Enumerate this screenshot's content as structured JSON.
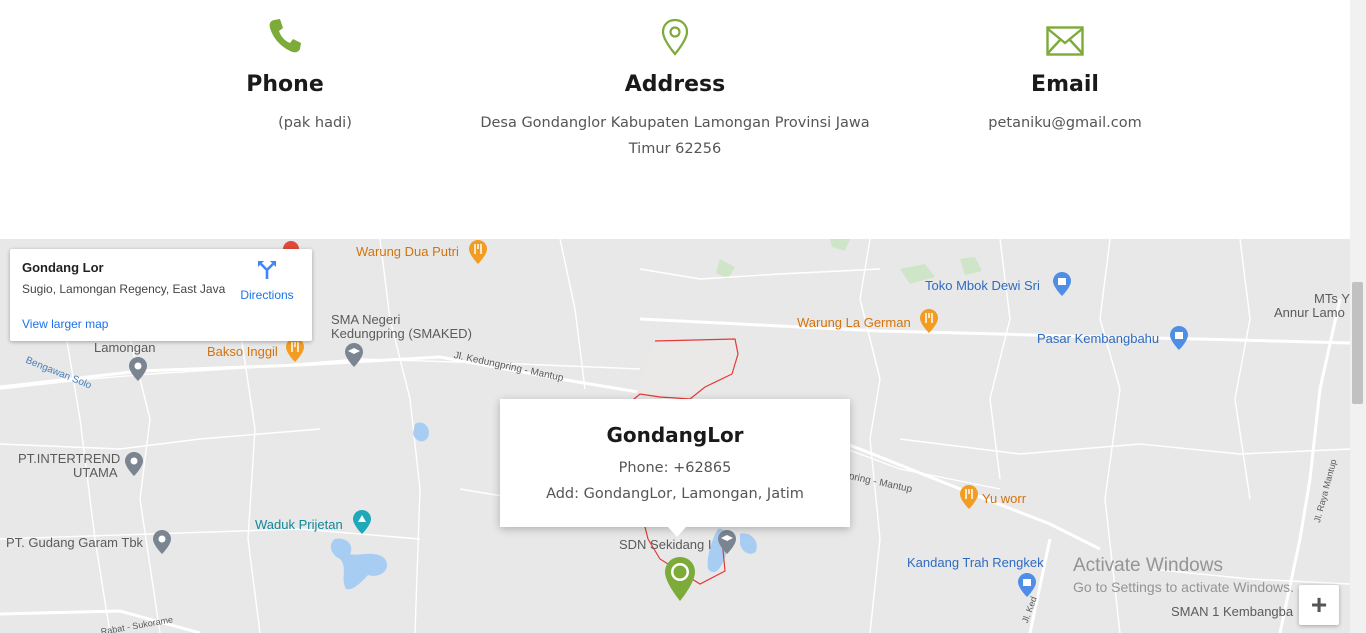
{
  "contact": {
    "phone": {
      "title": "Phone",
      "text": "(pak hadi)"
    },
    "address": {
      "title": "Address",
      "line1": "Desa Gondanglor Kabupaten Lamongan Provinsi Jawa",
      "line2": "Timur 62256"
    },
    "email": {
      "title": "Email",
      "text": "petaniku@gmail.com"
    }
  },
  "map": {
    "place_card": {
      "name": "Gondang Lor",
      "address": "Sugio, Lamongan Regency, East Java",
      "directions": "Directions",
      "view_larger": "View larger map"
    },
    "labels": {
      "warung_dua_putri": "Warung Dua Putri",
      "toko_mbok_dewi_sri": "Toko Mbok Dewi Sri",
      "mts_line1": "MTs Y",
      "mts_line2": "Annur Lamo",
      "warung_la_german": "Warung La German",
      "pasar_kembangbahu": "Pasar Kembangbahu",
      "sma_line1": "SMA Negeri",
      "sma_line2": "Kedungpring (SMAKED)",
      "lamongan": "Lamongan",
      "bakso_inggil": "Bakso Inggil",
      "jl_kedungpring": "Jl. Kedungpring - Mantup",
      "bengawan_solo": "Bengawan Solo",
      "pt_intertrend_line1": "PT.INTERTREND",
      "pt_intertrend_line2": "UTAMA",
      "waduk_prijetan": "Waduk Prijetan",
      "pt_gudang_garam": "PT. Gudang Garam Tbk",
      "pring_mantup": "pring - Mantup",
      "yu_worr": "Yu worr",
      "sdn_sekidang": "SDN Sekidang I",
      "kandang_trah": "Kandang Trah Rengkek",
      "sman1": "SMAN 1 Kembangba",
      "jl_raya_mantup": "Jl. Raya Mantup",
      "rabat_sukorame": "Rabat - Sukorame",
      "jl_ked": "Jl. Ked"
    },
    "info_window": {
      "title": "GondangLor",
      "phone": "Phone: +62865",
      "address": "Add: GondangLor, Lamongan, Jatim"
    },
    "zoom_in": "+"
  },
  "watermark": {
    "line1": "Activate Windows",
    "line2": "Go to Settings to activate Windows."
  },
  "colors": {
    "accent_green": "#7cab3a",
    "link_blue": "#1a73e8",
    "boundary_red": "#e53935"
  }
}
